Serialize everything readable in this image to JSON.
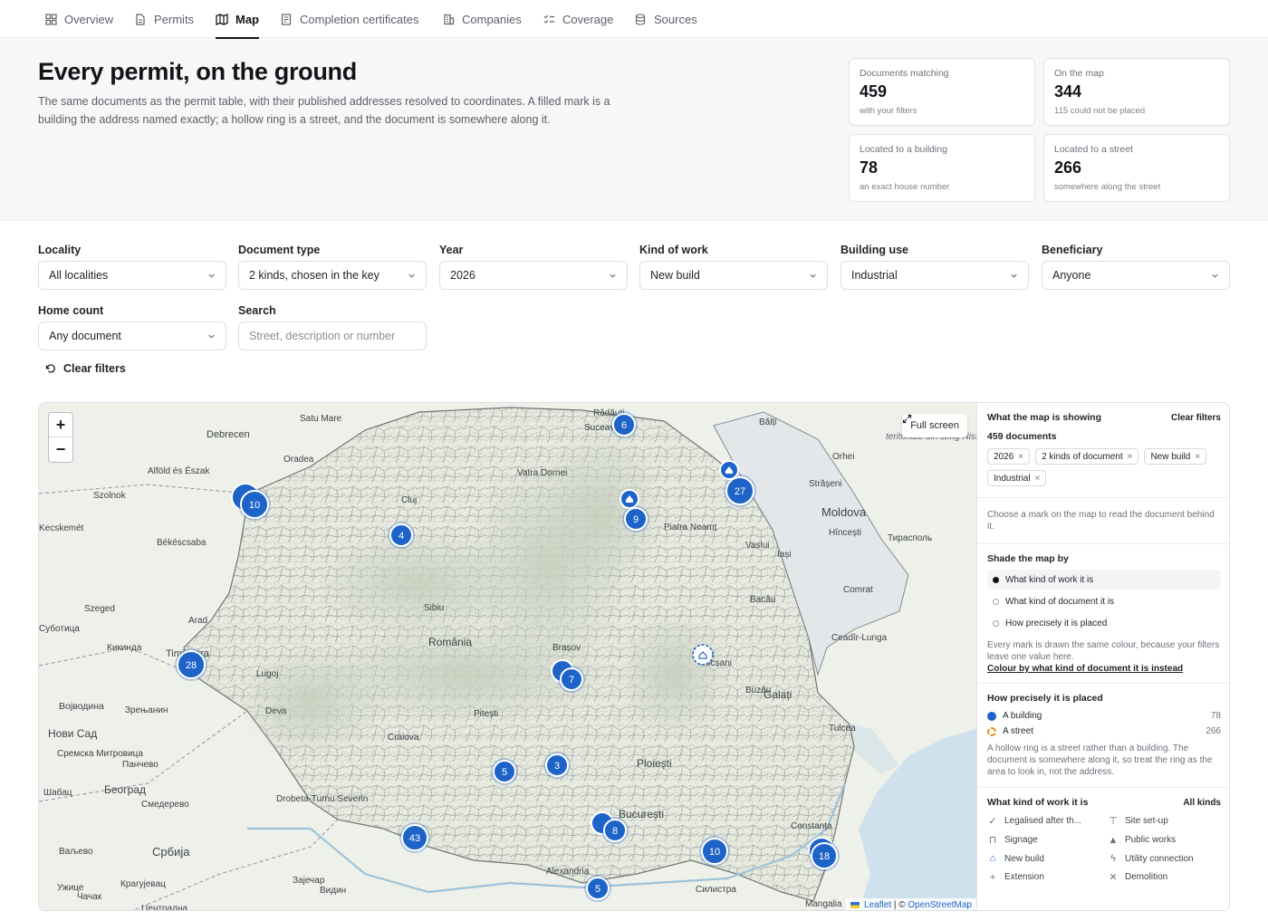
{
  "nav": {
    "tabs": [
      {
        "label": "Overview",
        "icon": "grid-icon"
      },
      {
        "label": "Permits",
        "icon": "document-icon"
      },
      {
        "label": "Map",
        "icon": "map-icon",
        "active": true
      },
      {
        "label": "Completion certificates",
        "icon": "certificate-icon"
      },
      {
        "label": "Companies",
        "icon": "building-icon"
      },
      {
        "label": "Coverage",
        "icon": "checklist-icon"
      },
      {
        "label": "Sources",
        "icon": "database-icon"
      }
    ]
  },
  "hero": {
    "title": "Every permit, on the ground",
    "description": "The same documents as the permit table, with their published addresses resolved to coordinates. A filled mark is a building the address named exactly; a hollow ring is a street, and the document is somewhere along it."
  },
  "stats": [
    {
      "label": "Documents matching",
      "value": "459",
      "sub": "with your filters"
    },
    {
      "label": "On the map",
      "value": "344",
      "sub": "115 could not be placed"
    },
    {
      "label": "Located to a building",
      "value": "78",
      "sub": "an exact house number"
    },
    {
      "label": "Located to a street",
      "value": "266",
      "sub": "somewhere along the street"
    }
  ],
  "filters": {
    "locality": {
      "label": "Locality",
      "value": "All localities"
    },
    "document_type": {
      "label": "Document type",
      "value": "2 kinds, chosen in the key"
    },
    "year": {
      "label": "Year",
      "value": "2026"
    },
    "kind_of_work": {
      "label": "Kind of work",
      "value": "New build"
    },
    "building_use": {
      "label": "Building use",
      "value": "Industrial"
    },
    "beneficiary": {
      "label": "Beneficiary",
      "value": "Anyone"
    },
    "home_count": {
      "label": "Home count",
      "value": "Any document"
    },
    "search": {
      "label": "Search",
      "placeholder": "Street, description or number",
      "value": ""
    },
    "clear_label": "Clear filters"
  },
  "map": {
    "fullscreen_label": "Full screen",
    "zoom_in": "+",
    "zoom_out": "−",
    "attribution": {
      "leaflet": "Leaflet",
      "sep": " | © ",
      "osm": "OpenStreetMap"
    },
    "place_labels": [
      {
        "text": "Debrecen"
      },
      {
        "text": "Szolnok"
      },
      {
        "text": "Kecskemét"
      },
      {
        "text": "Békéscsaba"
      },
      {
        "text": "Alföld és Észak"
      },
      {
        "text": "Szeged"
      },
      {
        "text": "Суботица"
      },
      {
        "text": "Кикинда"
      },
      {
        "text": "Војводина"
      },
      {
        "text": "Зрењанин"
      },
      {
        "text": "Нови Сад"
      },
      {
        "text": "Сремска Митровица"
      },
      {
        "text": "Панчево"
      },
      {
        "text": "Шабац"
      },
      {
        "text": "Београд"
      },
      {
        "text": "Смедерево"
      },
      {
        "text": "Ваљево"
      },
      {
        "text": "Србија"
      },
      {
        "text": "Ужице"
      },
      {
        "text": "Крагујевац"
      },
      {
        "text": "Чачак"
      },
      {
        "text": "Зајечар"
      },
      {
        "text": "Видин"
      },
      {
        "text": "Централна"
      },
      {
        "text": "Bălți"
      },
      {
        "text": "Orhei"
      },
      {
        "text": "Strășeni"
      },
      {
        "text": "Moldova"
      },
      {
        "text": "Hîncești"
      },
      {
        "text": "Тирасполь"
      },
      {
        "text": "Comrat"
      },
      {
        "text": "Ceadîr-Lunga"
      },
      {
        "text": "Galați"
      },
      {
        "text": "Tulcea"
      },
      {
        "text": "Rădăuți"
      },
      {
        "text": "Suceava"
      },
      {
        "text": "Vatra Dornei"
      },
      {
        "text": "Satu Mare"
      },
      {
        "text": "Oradea"
      },
      {
        "text": "Cluj"
      },
      {
        "text": "Arad"
      },
      {
        "text": "Timișoara"
      },
      {
        "text": "Lugoj"
      },
      {
        "text": "Deva"
      },
      {
        "text": "Sibiu"
      },
      {
        "text": "Brașov"
      },
      {
        "text": "România"
      },
      {
        "text": "Ploiești"
      },
      {
        "text": "Craiova"
      },
      {
        "text": "Pitești"
      },
      {
        "text": "București"
      },
      {
        "text": "Constanța"
      },
      {
        "text": "Силистра"
      },
      {
        "text": "Mangalia"
      },
      {
        "text": "Iași"
      },
      {
        "text": "Vaslui"
      },
      {
        "text": "Bacău"
      },
      {
        "text": "Piatra Neamț"
      },
      {
        "text": "Focșani"
      },
      {
        "text": "Buzău"
      },
      {
        "text": "Alexandria"
      },
      {
        "text": "Drobeta-Turnu Severin"
      },
      {
        "text": "teritoriale din stîng Nistrului"
      }
    ],
    "clusters": [
      {
        "count": "6",
        "kind": "cluster"
      },
      {
        "count": "27",
        "kind": "cluster"
      },
      {
        "count": "9",
        "kind": "cluster"
      },
      {
        "count": "10",
        "kind": "cluster"
      },
      {
        "count": "4",
        "kind": "cluster"
      },
      {
        "count": "28",
        "kind": "cluster"
      },
      {
        "count": "7",
        "kind": "cluster"
      },
      {
        "count": "5",
        "kind": "cluster"
      },
      {
        "count": "3",
        "kind": "cluster"
      },
      {
        "count": "8",
        "kind": "cluster"
      },
      {
        "count": "43",
        "kind": "cluster"
      },
      {
        "count": "10",
        "kind": "cluster"
      },
      {
        "count": "18",
        "kind": "cluster"
      },
      {
        "count": "5",
        "kind": "cluster"
      }
    ]
  },
  "panel": {
    "showing": {
      "title": "What the map is showing",
      "clear_label": "Clear filters",
      "count_text": "459 documents",
      "chips": [
        "2026",
        "2 kinds of document",
        "New build",
        "Industrial"
      ],
      "chip_remove": "×"
    },
    "choose_note": "Choose a mark on the map to read the document behind it.",
    "shade": {
      "title": "Shade the map by",
      "options": [
        {
          "label": "What kind of work it is",
          "selected": true
        },
        {
          "label": "What kind of document it is",
          "selected": false
        },
        {
          "label": "How precisely it is placed",
          "selected": false
        }
      ],
      "note": "Every mark is drawn the same colour, because your filters leave one value here.",
      "link": "Colour by what kind of document it is instead"
    },
    "precision": {
      "title": "How precisely it is placed",
      "rows": [
        {
          "label": "A building",
          "count": "78",
          "color": "#1e63c7"
        },
        {
          "label": "A street",
          "count": "266",
          "color": "#e08a1e"
        }
      ],
      "note": "A hollow ring is a street rather than a building. The document is somewhere along it, so treat the ring as the area to look in, not the address."
    },
    "kinds": {
      "title": "What kind of work it is",
      "all_label": "All kinds",
      "items": [
        {
          "label": "Legalised after th...",
          "icon": "check-icon"
        },
        {
          "label": "Site set-up",
          "icon": "crane-icon"
        },
        {
          "label": "Signage",
          "icon": "sign-icon"
        },
        {
          "label": "Public works",
          "icon": "cone-icon"
        },
        {
          "label": "New build",
          "icon": "house-icon",
          "active": true
        },
        {
          "label": "Utility connection",
          "icon": "bolt-icon"
        },
        {
          "label": "Extension",
          "icon": "plus-icon"
        },
        {
          "label": "Demolition",
          "icon": "x-icon"
        }
      ]
    }
  },
  "colors": {
    "accent": "#1e63c7",
    "street": "#e08a1e",
    "text": "#1f2328",
    "muted": "#6b7179"
  }
}
